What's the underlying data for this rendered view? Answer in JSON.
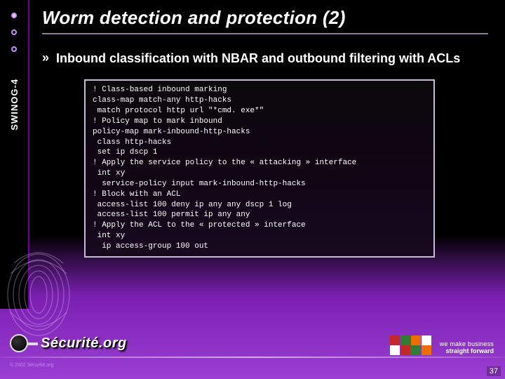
{
  "sidebar": {
    "label": "SWINOG-4"
  },
  "slide": {
    "title": "Worm detection and protection (2)",
    "bullet": "Inbound classification with NBAR and outbound filtering with ACLs",
    "code": "! Class-based inbound marking\nclass-map match-any http-hacks\n match protocol http url \"*cmd. exe*\"\n! Policy map to mark inbound\npolicy-map mark-inbound-http-hacks\n class http-hacks\n set ip dscp 1\n! Apply the service policy to the « attacking » interface\n int xy\n  service-policy input mark-inbound-http-hacks\n! Block with an ACL\n access-list 100 deny ip any any dscp 1 log\n access-list 100 permit ip any any\n! Apply the ACL to the « protected » interface\n int xy\n  ip access-group 100 out"
  },
  "footer": {
    "brand": "Sécurité.org",
    "tagline_line1": "we make business",
    "tagline_line2": "straight forward",
    "page_number": "37",
    "copyright": "© 2002 Sécurité.org"
  }
}
